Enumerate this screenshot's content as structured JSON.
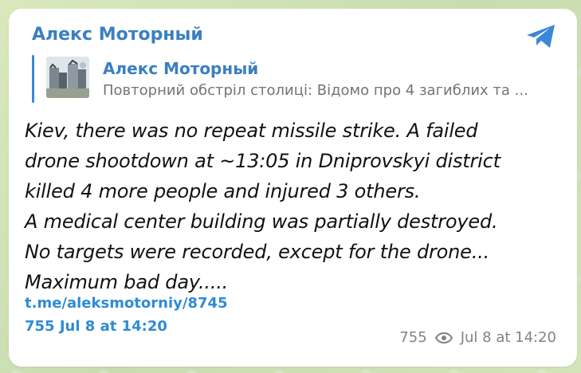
{
  "header": {
    "channel_name": "Алекс Моторный",
    "telegram_icon": "telegram-icon"
  },
  "reply": {
    "name": "Алекс Моторный",
    "text": "Повторний обстріл столиці: Відомо про 4 загиблих та ...",
    "thumbnail": "destroyed-building-thumbnail"
  },
  "message": {
    "lines": [
      "Kiev, there was no repeat missile strike. A failed",
      "drone shootdown at ~13:05 in Dniprovskyi district",
      "killed 4 more people and injured 3 others.",
      "A medical center building was partially destroyed.",
      "No targets were recorded, except for the drone...",
      "Maximum bad day....."
    ],
    "link": "t.me/aleksmotorniy/8745",
    "inline_meta": "755 Jul 8 at 14:20"
  },
  "footer": {
    "views": "755",
    "time": "Jul 8 at 14:20",
    "views_icon": "eye-icon"
  },
  "colors": {
    "accent": "#3a7fc1",
    "link": "#2f8bd5",
    "background": "#cfe1b5",
    "meta": "#7d8489"
  }
}
